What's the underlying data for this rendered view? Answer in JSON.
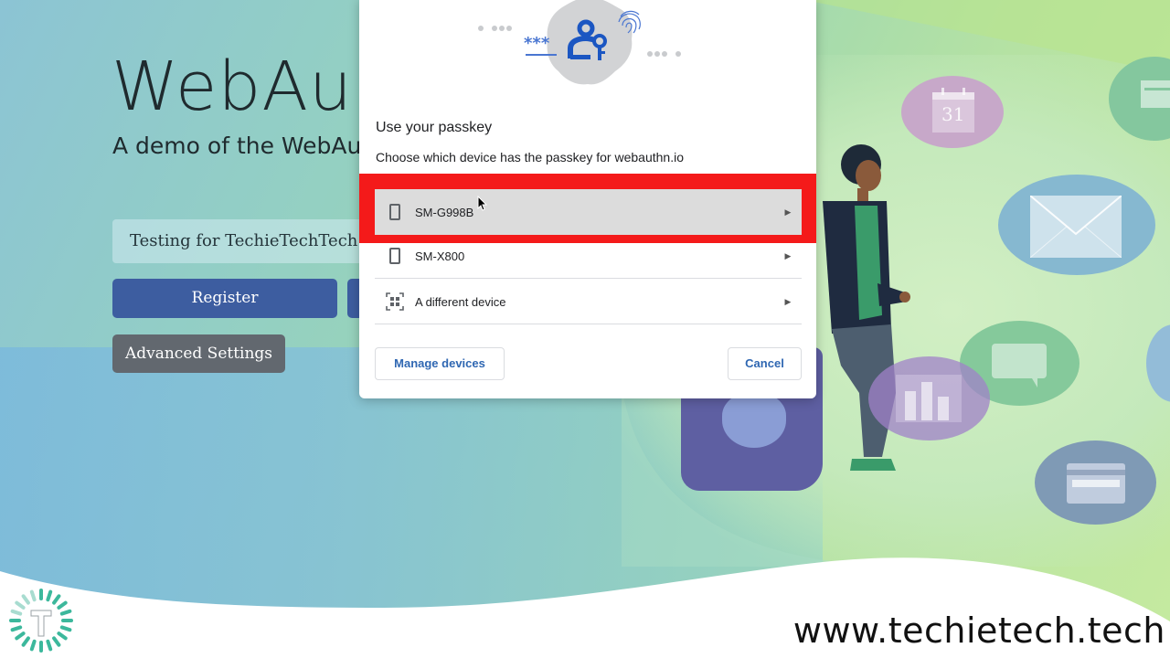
{
  "page": {
    "title": "WebAu",
    "subtitle": "A demo of the WebAu",
    "username_value": "Testing for TechieTechTech",
    "register_label": "Register",
    "advanced_settings_label": "Advanced Settings"
  },
  "dialog": {
    "title": "Use your passkey",
    "subtitle": "Choose which device has the passkey for webauthn.io",
    "devices": [
      {
        "label": "SM-G998B",
        "icon": "phone-icon",
        "selected": true
      },
      {
        "label": "SM-X800",
        "icon": "phone-icon",
        "selected": false
      },
      {
        "label": "A different device",
        "icon": "qr-grid-icon",
        "selected": false
      }
    ],
    "manage_devices_label": "Manage devices",
    "cancel_label": "Cancel",
    "illustration": {
      "asterisks": "***"
    }
  },
  "illustration": {
    "calendar_day": "31"
  },
  "branding": {
    "site_url": "www.techietech.tech"
  },
  "colors": {
    "highlight": "#f41a1a",
    "primary_button": "#3d5da0",
    "secondary_button": "#62686f",
    "link_blue": "#2f67b2"
  }
}
